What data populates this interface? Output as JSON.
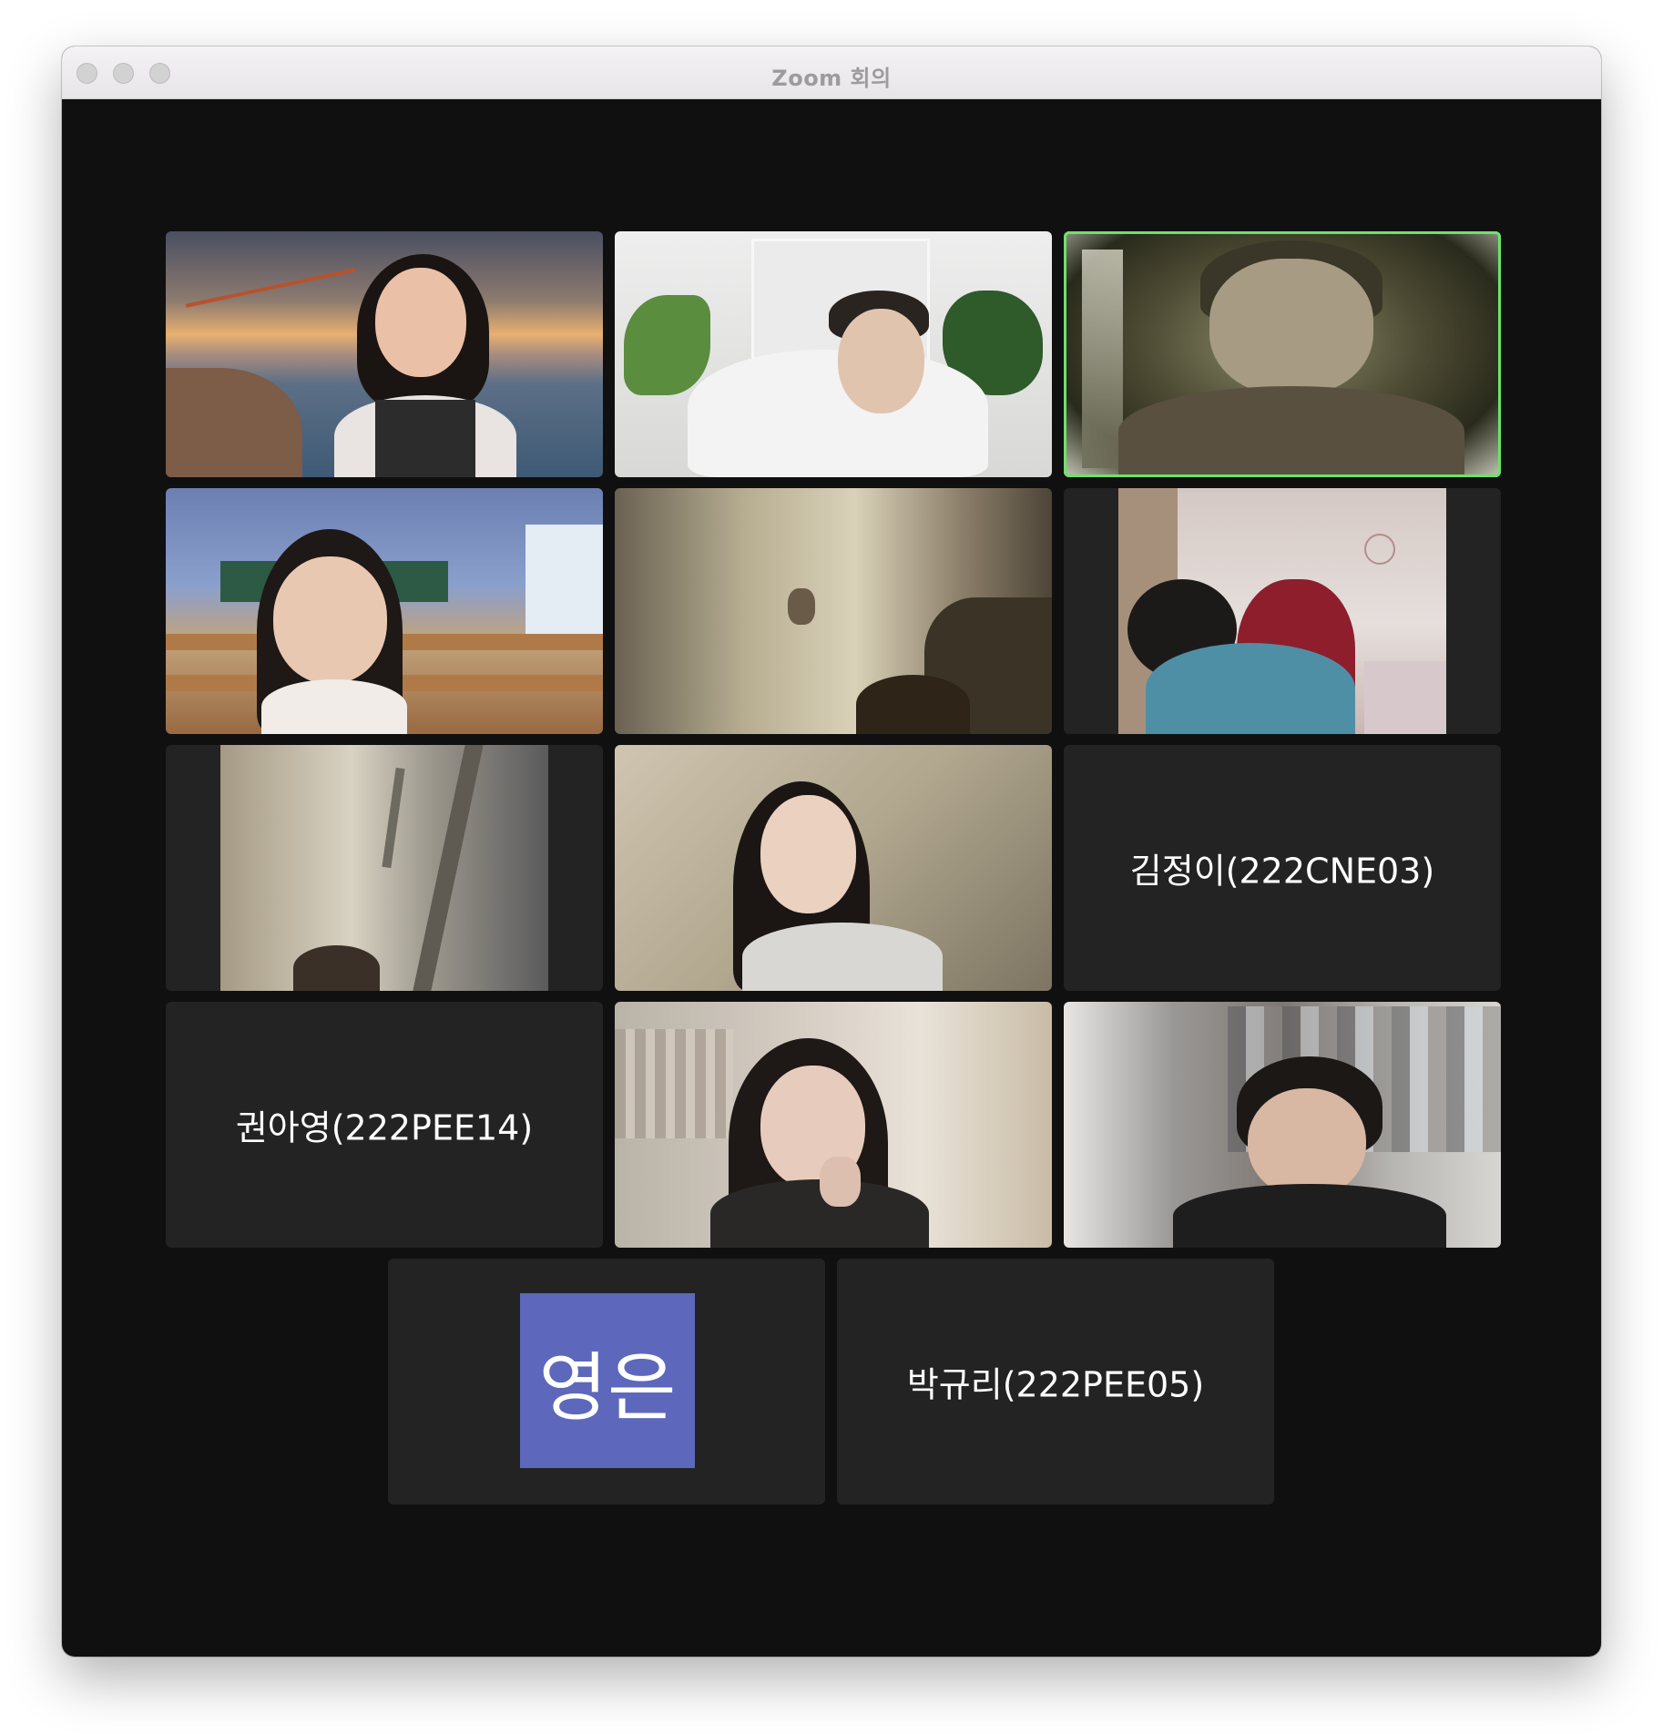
{
  "window": {
    "title": "Zoom 회의"
  },
  "participants": [
    {
      "type": "video",
      "active": false
    },
    {
      "type": "video",
      "active": false
    },
    {
      "type": "video",
      "active": true
    },
    {
      "type": "video",
      "active": false
    },
    {
      "type": "video",
      "active": false
    },
    {
      "type": "video",
      "active": false
    },
    {
      "type": "video",
      "active": false
    },
    {
      "type": "video",
      "active": false
    },
    {
      "type": "name",
      "name": "김정이(222CNE03)",
      "active": false
    },
    {
      "type": "name",
      "name": "권아영(222PEE14)",
      "active": false
    },
    {
      "type": "video",
      "active": false
    },
    {
      "type": "video",
      "active": false
    },
    {
      "type": "avatar",
      "initials": "영은",
      "avatar_color": "#5d67bb",
      "active": false
    },
    {
      "type": "name",
      "name": "박규리(222PEE05)",
      "active": false
    }
  ],
  "colors": {
    "active_speaker_border": "#6ce26d",
    "tile_background": "#232323",
    "meeting_background": "#101010"
  }
}
